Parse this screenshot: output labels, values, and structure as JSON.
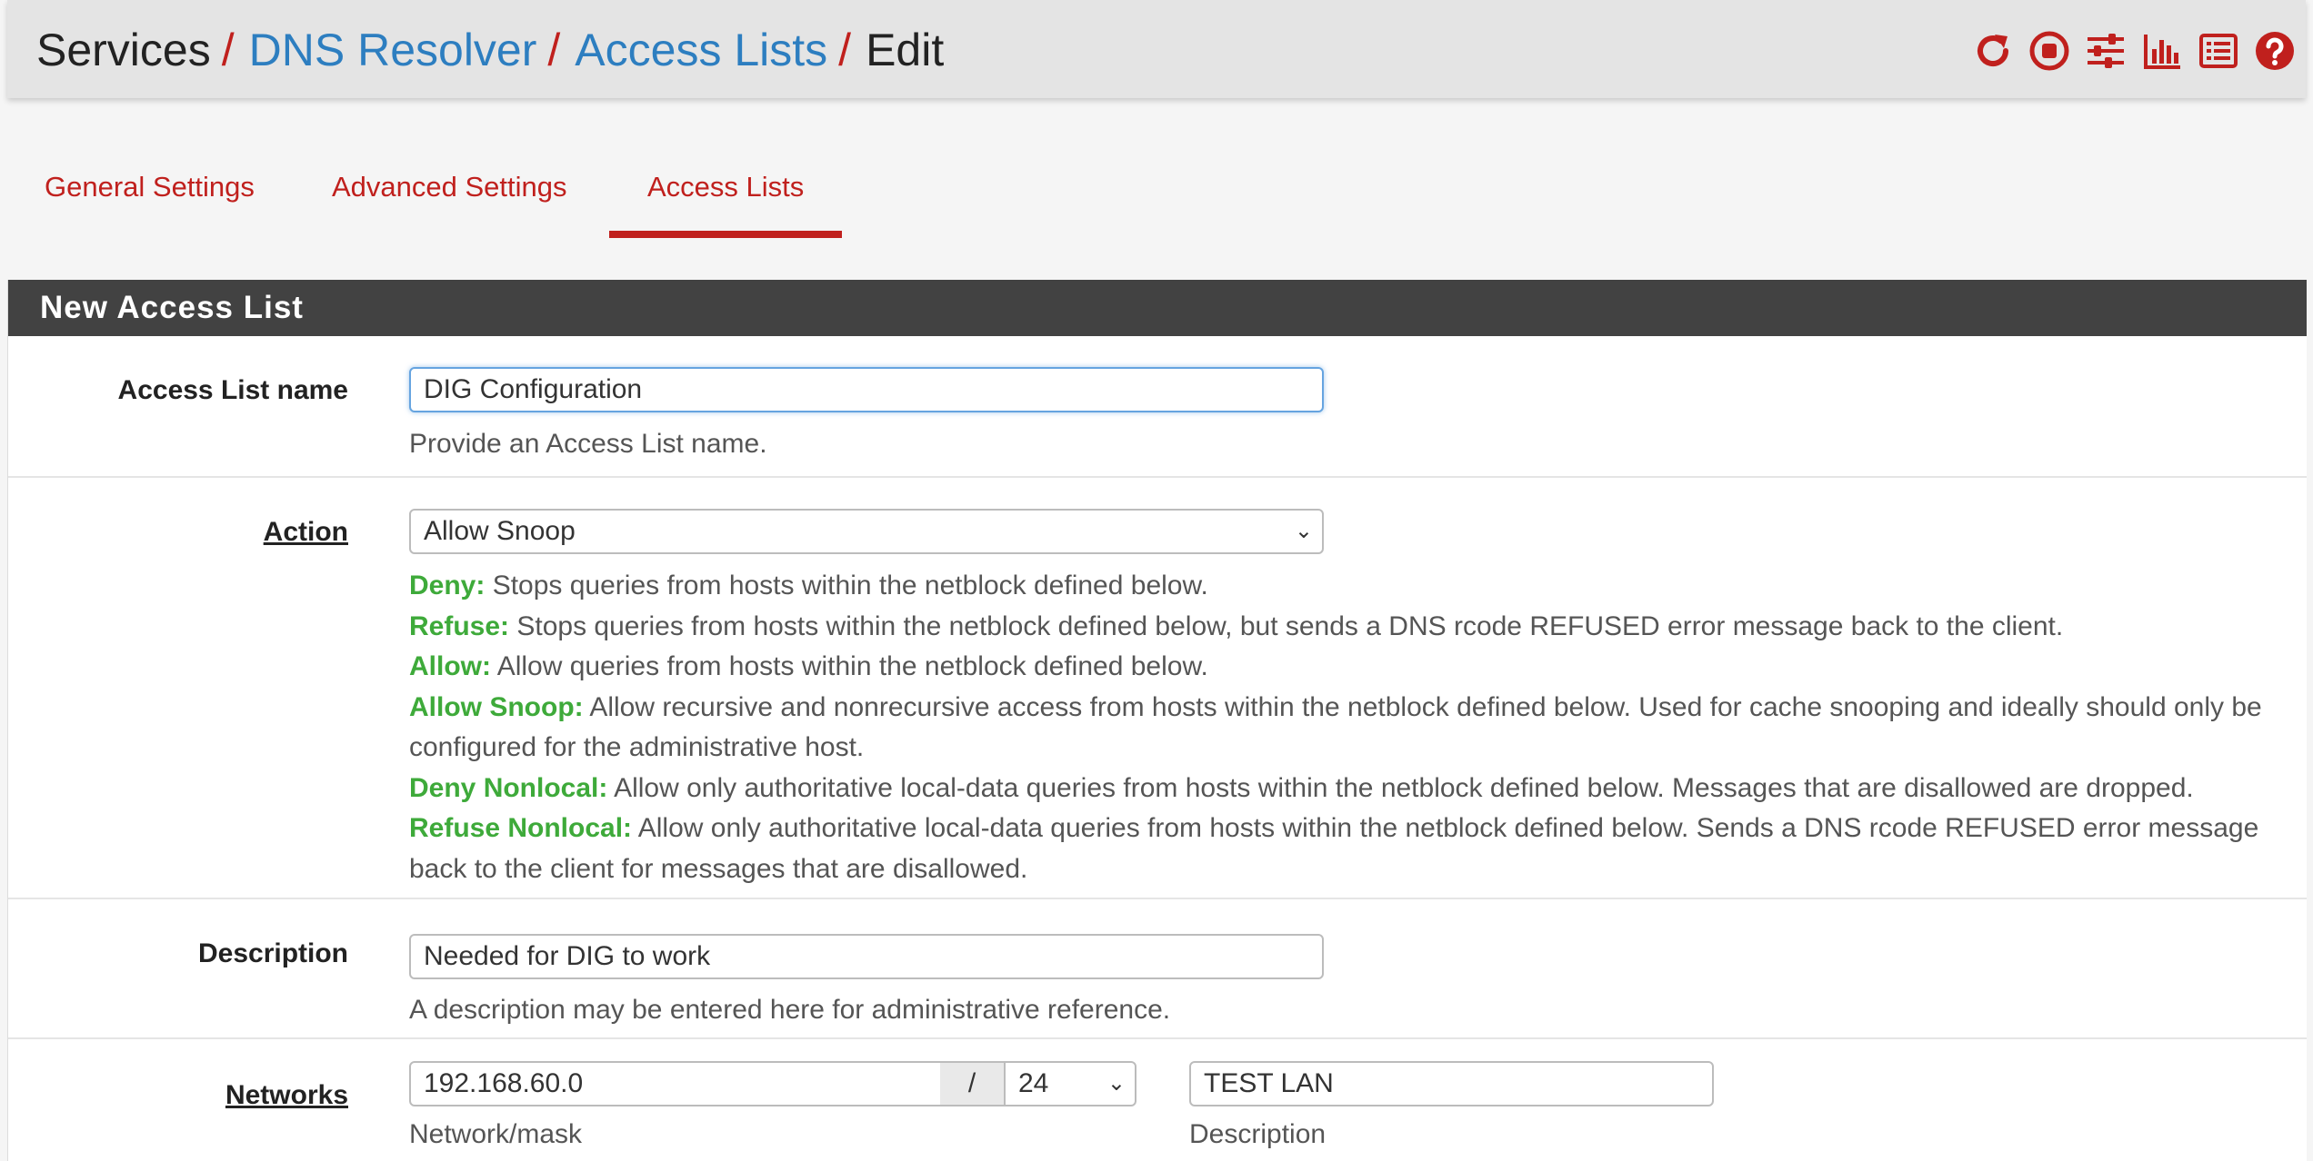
{
  "breadcrumb": {
    "items": [
      "Services",
      "DNS Resolver",
      "Access Lists",
      "Edit"
    ],
    "separator": "/"
  },
  "header_icons": [
    "reload-icon",
    "stop-service-icon",
    "settings-sliders-icon",
    "status-chart-icon",
    "log-list-icon",
    "help-icon"
  ],
  "tabs": [
    {
      "label": "General Settings",
      "active": false
    },
    {
      "label": "Advanced Settings",
      "active": false
    },
    {
      "label": "Access Lists",
      "active": true
    }
  ],
  "panel": {
    "title": "New Access List"
  },
  "form": {
    "name": {
      "label": "Access List name",
      "value": "DIG Configuration",
      "help": "Provide an Access List name."
    },
    "action": {
      "label": "Action",
      "value": "Allow Snoop",
      "help": [
        {
          "term": "Deny:",
          "text": "Stops queries from hosts within the netblock defined below."
        },
        {
          "term": "Refuse:",
          "text": "Stops queries from hosts within the netblock defined below, but sends a DNS rcode REFUSED error message back to the client."
        },
        {
          "term": "Allow:",
          "text": "Allow queries from hosts within the netblock defined below."
        },
        {
          "term": "Allow Snoop:",
          "text": "Allow recursive and nonrecursive access from hosts within the netblock defined below. Used for cache snooping and ideally should only be configured for the administrative host."
        },
        {
          "term": "Deny Nonlocal:",
          "text": "Allow only authoritative local-data queries from hosts within the netblock defined below. Messages that are disallowed are dropped."
        },
        {
          "term": "Refuse Nonlocal:",
          "text": "Allow only authoritative local-data queries from hosts within the netblock defined below. Sends a DNS rcode REFUSED error message back to the client for messages that are disallowed."
        }
      ]
    },
    "description": {
      "label": "Description",
      "value": "Needed for DIG to work",
      "help": "A description may be entered here for administrative reference."
    },
    "networks": {
      "label": "Networks",
      "network_value": "192.168.60.0",
      "mask_separator": "/",
      "mask_value": "24",
      "network_help": "Network/mask",
      "description_value": "TEST LAN",
      "description_help": "Description"
    }
  },
  "colors": {
    "accent_red": "#c0201d",
    "link_blue": "#2d7ec0",
    "term_green": "#3eaa3a",
    "panel_header": "#424242"
  }
}
